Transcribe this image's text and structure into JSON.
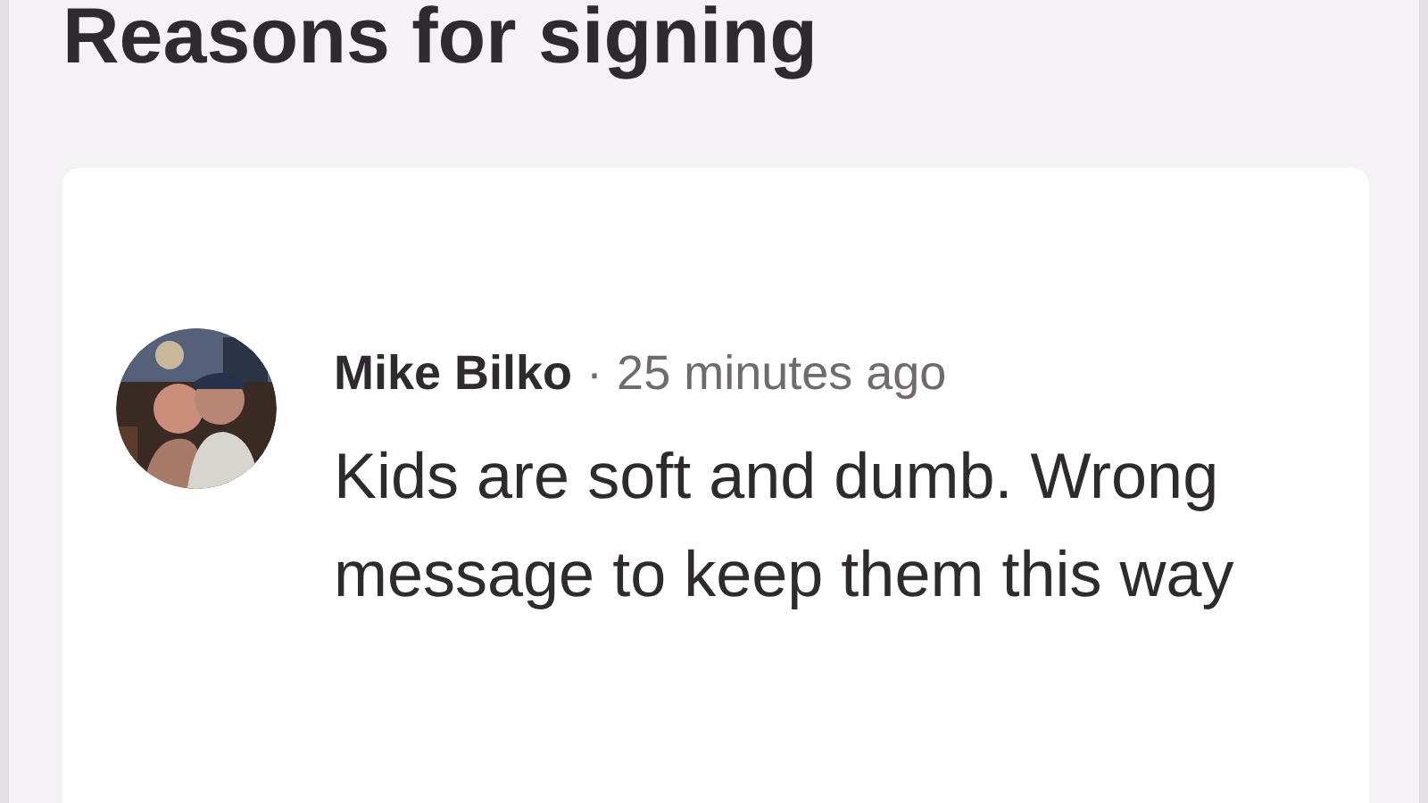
{
  "heading": "Reasons for signing",
  "comment": {
    "author": "Mike Bilko",
    "separator": "·",
    "time": "25 minutes ago",
    "text": "Kids are soft and dumb. Wrong message to keep them this way"
  }
}
